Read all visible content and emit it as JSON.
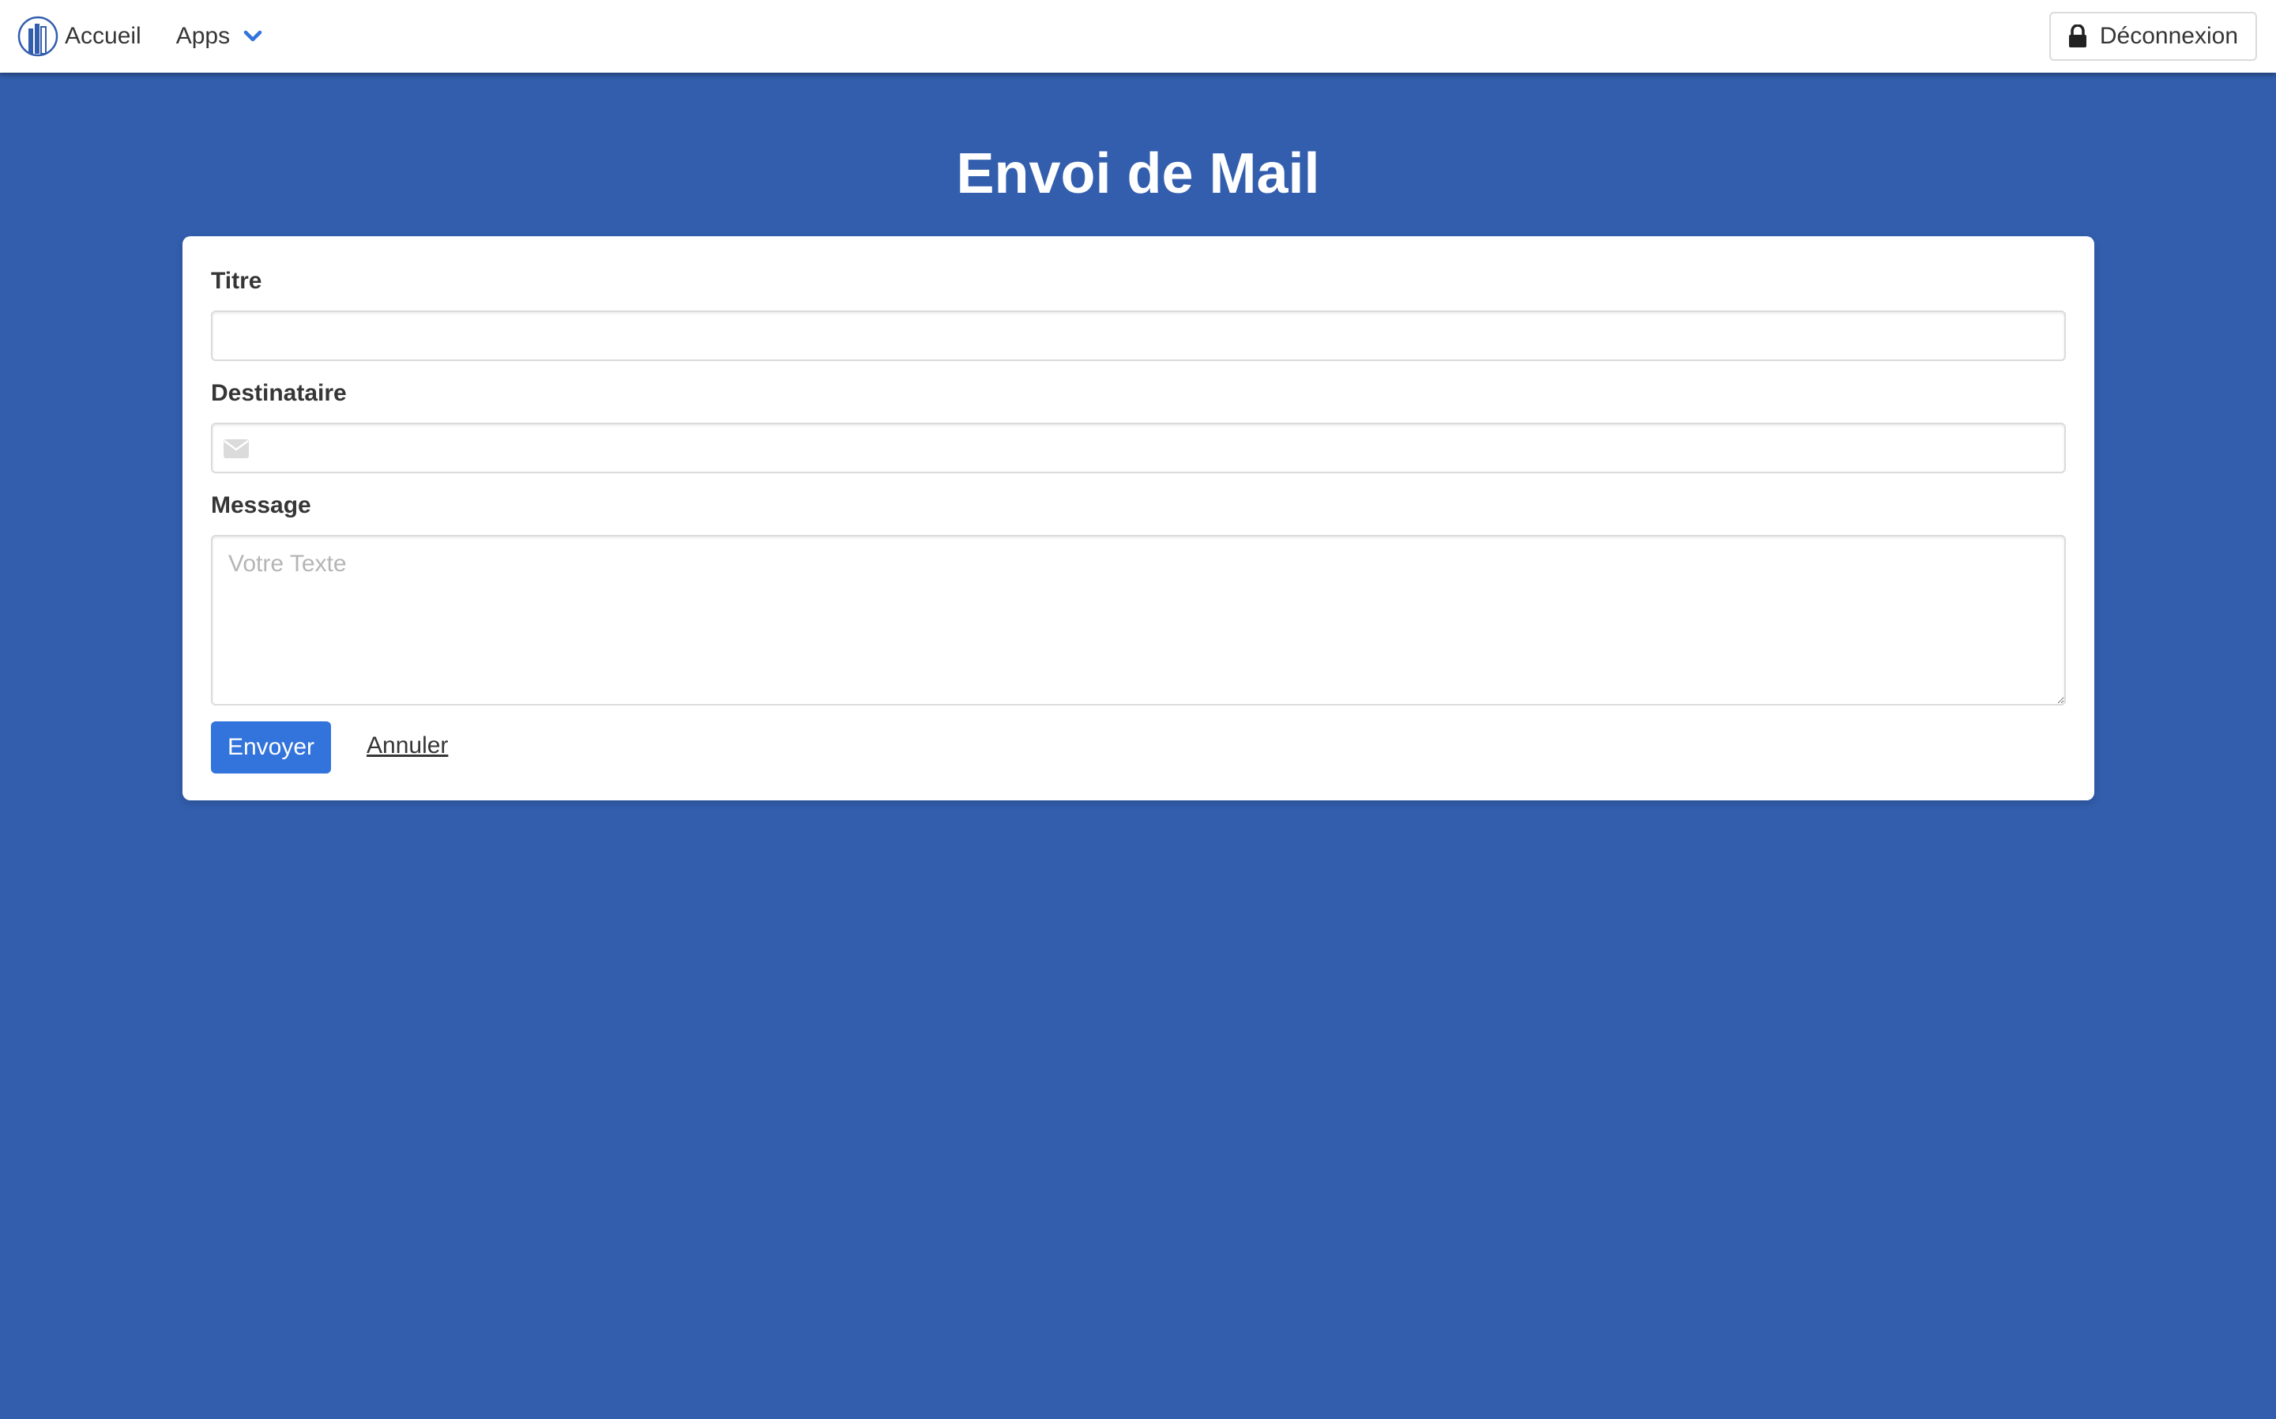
{
  "navbar": {
    "home_label": "Accueil",
    "apps_label": "Apps",
    "logout_label": "Déconnexion"
  },
  "page": {
    "title": "Envoi de Mail"
  },
  "form": {
    "title_label": "Titre",
    "title_value": "",
    "recipient_label": "Destinataire",
    "recipient_value": "",
    "message_label": "Message",
    "message_placeholder": "Votre Texte",
    "send_label": "Envoyer",
    "cancel_label": "Annuler"
  },
  "colors": {
    "background": "#325ead",
    "primary_button": "#3273dc",
    "accent_chevron": "#3273dc"
  },
  "icons": {
    "logo": "building-logo-icon",
    "apps_dropdown": "chevron-down-icon",
    "logout": "lock-icon",
    "recipient": "envelope-icon"
  }
}
